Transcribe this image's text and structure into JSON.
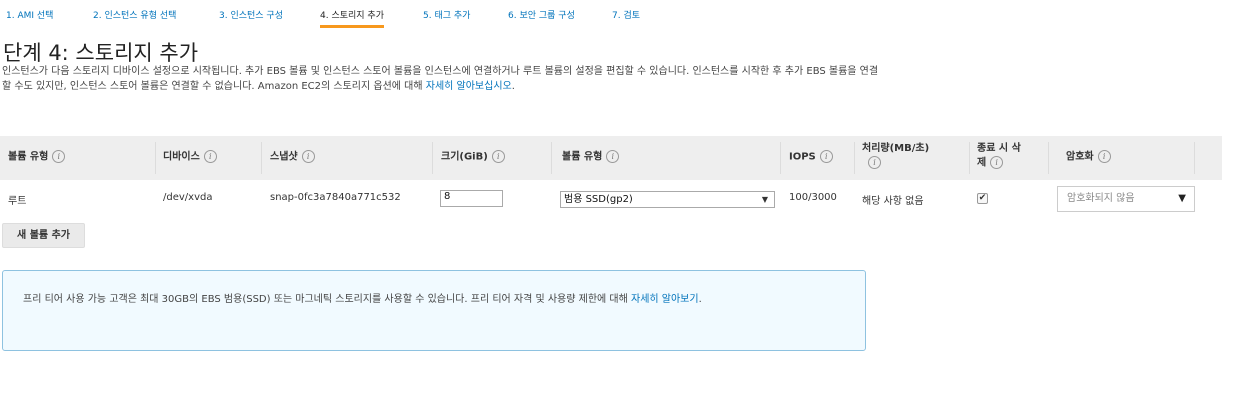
{
  "wizard": {
    "steps": [
      {
        "label": "1. AMI 선택"
      },
      {
        "label": "2. 인스턴스 유형 선택"
      },
      {
        "label": "3. 인스턴스 구성"
      },
      {
        "label": "4. 스토리지 추가"
      },
      {
        "label": "5. 태그 추가"
      },
      {
        "label": "6. 보안 그룹 구성"
      },
      {
        "label": "7. 검토"
      }
    ],
    "active_step": 3
  },
  "page": {
    "title": "단계 4: 스토리지 추가",
    "description_prefix": "인스턴스가 다음 스토리지 디바이스 설정으로 시작됩니다. 추가 EBS 볼륨 및 인스턴스 스토어 볼륨을 인스턴스에 연결하거나 루트 볼륨의 설정을 편집할 수 있습니다. 인스턴스를 시작한 후 추가 EBS 볼륨을 연결할 수도 있지만, 인스턴스 스토어 볼륨은 연결할 수 없습니다. Amazon EC2의 스토리지 옵션에 대해 ",
    "description_link": "자세히 알아보십시오",
    "description_suffix": "."
  },
  "table": {
    "headers": {
      "volume_type": "볼륨 유형",
      "device": "디바이스",
      "snapshot": "스냅샷",
      "size": "크기(GiB)",
      "ebs_type": "볼륨 유형",
      "iops": "IOPS",
      "throughput_line1": "처리량(MB/초)",
      "delete_line1": "종료 시 삭",
      "delete_line2": "제",
      "encryption": "암호화"
    },
    "info_glyph": "i",
    "rows": [
      {
        "volume_type": "루트",
        "device": "/dev/xvda",
        "snapshot": "snap-0fc3a7840a771c532",
        "size": "8",
        "ebs_type": "범용 SSD(gp2)",
        "iops": "100/3000",
        "throughput": "해당 사항 없음",
        "delete_on_termination": true,
        "encryption": "암호화되지 않음"
      }
    ]
  },
  "add_volume_button": "새 볼륨 추가",
  "free_tier": {
    "text": "프리 티어 사용 가능 고객은 최대 30GB의 EBS 범용(SSD) 또는 마그네틱 스토리지를 사용할 수 있습니다. 프리 티어 자격 및 사용량 제한에 대해 ",
    "link": "자세히 알아보기",
    "suffix": "."
  },
  "colors": {
    "link": "#0073bb",
    "active_step_underline": "#f7981d",
    "table_header_bg": "#eeeeee",
    "info_box_bg": "#f1faff",
    "info_box_border": "#8ec2e0"
  }
}
